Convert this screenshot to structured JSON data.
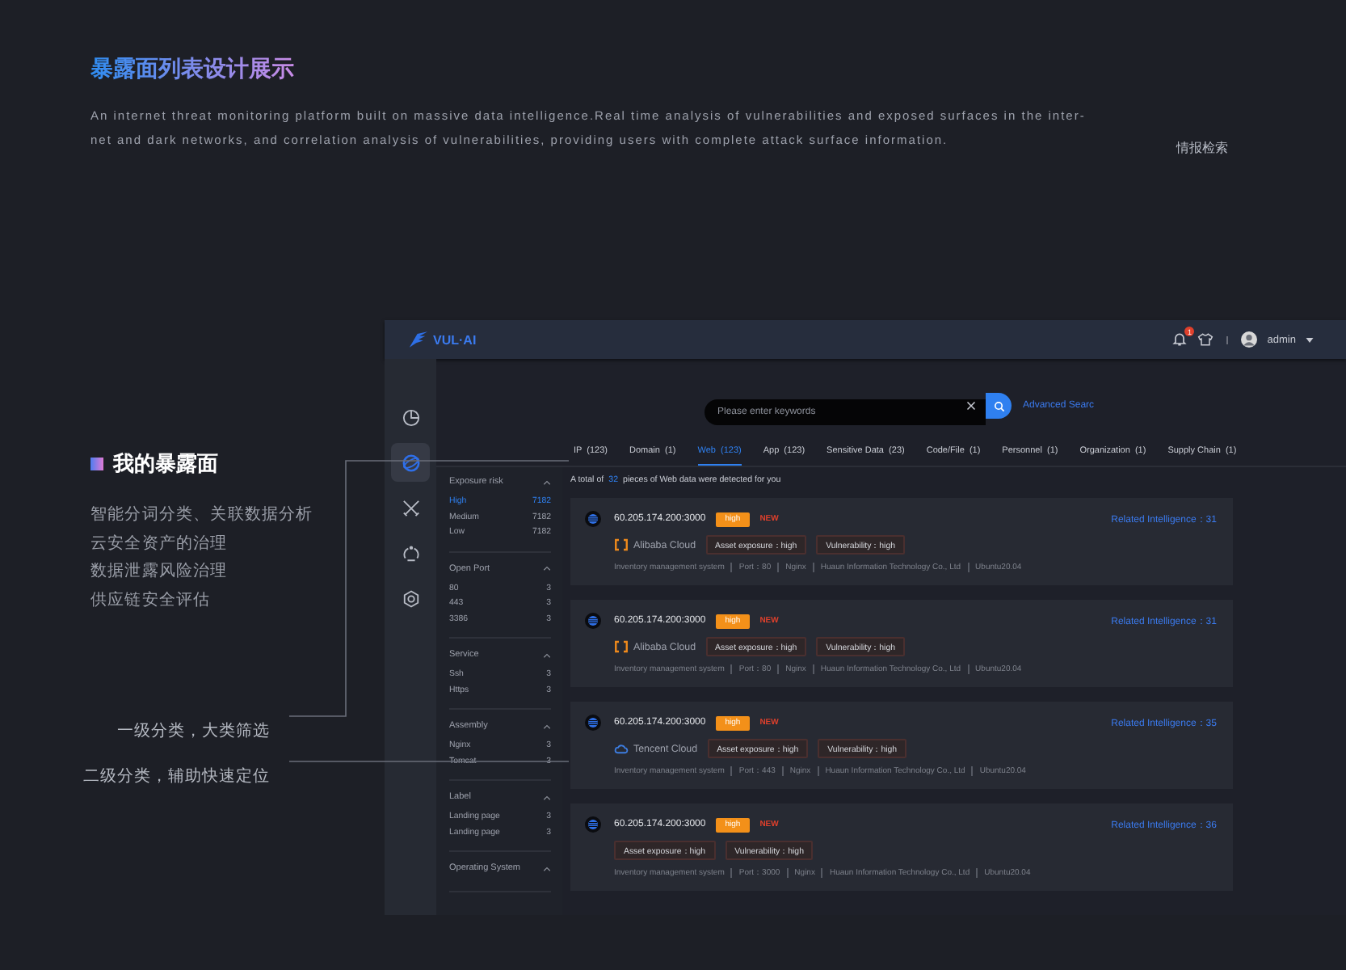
{
  "title": "暴露面列表设计展示",
  "description": [
    "An internet threat monitoring platform built on massive data intelligence.Real time analysis of vulnerabilities and exposed surfaces in the inter-",
    "net and dark networks, and correlation analysis of vulnerabilities, providing users with complete attack surface information."
  ],
  "side_note": "情报检索",
  "feature": {
    "heading": "我的暴露面",
    "points": [
      "智能分词分类、关联数据分析",
      "云安全资产的治理",
      "数据泄露风险治理",
      "供应链安全评估"
    ]
  },
  "annotations": [
    "一级分类，大类筛选",
    "二级分类，辅助快速定位"
  ],
  "app": {
    "logo": "VUL·AI",
    "notification_count": "1",
    "user": "admin",
    "nav": [
      {
        "kind": "pie",
        "selected": false
      },
      {
        "kind": "globe",
        "selected": true
      },
      {
        "kind": "swords",
        "selected": false
      },
      {
        "kind": "cycle",
        "selected": false
      },
      {
        "kind": "gear",
        "selected": false
      }
    ],
    "search": {
      "placeholder": "Please enter keywords",
      "advanced": "Advanced Searc"
    },
    "tabs": [
      {
        "label": "IP  (123)",
        "selected": false
      },
      {
        "label": "Domain  (1)",
        "selected": false
      },
      {
        "label": "Web  (123)",
        "selected": true
      },
      {
        "label": "App  (123)",
        "selected": false
      },
      {
        "label": "Sensitive Data  (23)",
        "selected": false
      },
      {
        "label": "Code/File  (1)",
        "selected": false
      },
      {
        "label": "Personnel  (1)",
        "selected": false
      },
      {
        "label": "Organization  (1)",
        "selected": false
      },
      {
        "label": "Supply Chain  (1)",
        "selected": false
      }
    ],
    "filters": [
      {
        "title": "Exposure risk",
        "items": [
          {
            "label": "High",
            "count": "7182",
            "selected": true
          },
          {
            "label": "Medium",
            "count": "7182",
            "selected": false
          },
          {
            "label": "Low",
            "count": "7182",
            "selected": false
          }
        ]
      },
      {
        "title": "Open Port",
        "items": [
          {
            "label": "80",
            "count": "3",
            "selected": false
          },
          {
            "label": "443",
            "count": "3",
            "selected": false
          },
          {
            "label": "3386",
            "count": "3",
            "selected": false
          }
        ]
      },
      {
        "title": "Service",
        "items": [
          {
            "label": "Ssh",
            "count": "3",
            "selected": false
          },
          {
            "label": "Https",
            "count": "3",
            "selected": false
          }
        ]
      },
      {
        "title": "Assembly",
        "items": [
          {
            "label": "Nginx",
            "count": "3",
            "selected": false
          },
          {
            "label": "Tomcat",
            "count": "3",
            "selected": false
          }
        ]
      },
      {
        "title": "Label",
        "items": [
          {
            "label": "Landing page",
            "count": "3",
            "selected": false
          },
          {
            "label": "Landing page",
            "count": "3",
            "selected": false
          }
        ]
      },
      {
        "title": "Operating System"
      }
    ],
    "summary": {
      "prefix": "A total of",
      "count": "32",
      "suffix": "pieces of Web data were detected for you"
    },
    "results": [
      {
        "address": "60.205.174.200:3000",
        "risk": "high",
        "badge": "NEW",
        "related": "Related Intelligence：",
        "related_count": "31",
        "cloud": {
          "kind": "alibaba",
          "name": "Alibaba Cloud"
        },
        "tags": [
          "Asset exposure：high",
          "Vulnerability：high"
        ],
        "details": [
          "Inventory management system",
          "Port：80",
          "Nginx",
          "Huaun Information Technology Co., Ltd",
          "Ubuntu20.04"
        ]
      },
      {
        "address": "60.205.174.200:3000",
        "risk": "high",
        "badge": "NEW",
        "related": "Related Intelligence：",
        "related_count": "31",
        "cloud": {
          "kind": "alibaba",
          "name": "Alibaba Cloud"
        },
        "tags": [
          "Asset exposure：high",
          "Vulnerability：high"
        ],
        "details": [
          "Inventory management system",
          "Port：80",
          "Nginx",
          "Huaun Information Technology Co., Ltd",
          "Ubuntu20.04"
        ]
      },
      {
        "address": "60.205.174.200:3000",
        "risk": "high",
        "badge": "NEW",
        "related": "Related Intelligence：",
        "related_count": "35",
        "cloud": {
          "kind": "tencent",
          "name": "Tencent Cloud"
        },
        "tags": [
          "Asset exposure：high",
          "Vulnerability：high"
        ],
        "details": [
          "Inventory management system",
          "Port：443",
          "Nginx",
          "Huaun Information Technology Co., Ltd",
          "Ubuntu20.04"
        ]
      },
      {
        "address": "60.205.174.200:3000",
        "risk": "high",
        "badge": "NEW",
        "related": "Related Intelligence：",
        "related_count": "36",
        "tags": [
          "Asset exposure：high",
          "Vulnerability：high"
        ],
        "details": [
          "Inventory management system",
          "Port：3000",
          "Nginx",
          "Huaun Information Technology Co., Ltd",
          "Ubuntu20.04"
        ]
      }
    ]
  }
}
